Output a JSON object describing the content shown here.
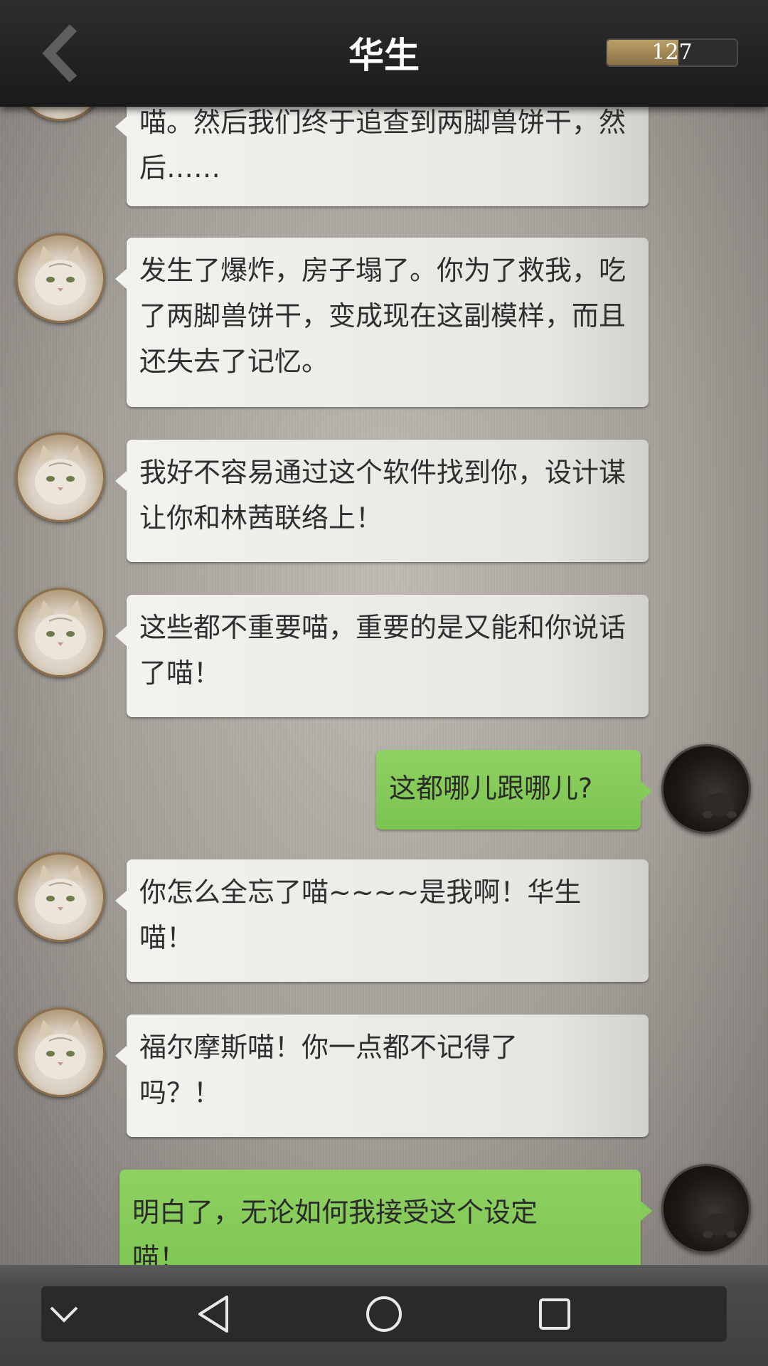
{
  "header": {
    "title": "华生",
    "counter_value": "127",
    "counter_fill_fraction": 0.55,
    "back_icon": "chevron-left-icon"
  },
  "messages": [
    {
      "side": "left",
      "text": "喵。然后我们终于追查到两脚兽饼干，然后……"
    },
    {
      "side": "left",
      "text": "发生了爆炸，房子塌了。你为了救我，吃了两脚兽饼干，变成现在这副模样，而且还失去了记忆。"
    },
    {
      "side": "left",
      "text": "我好不容易通过这个软件找到你，设计谋让你和林茜联络上！"
    },
    {
      "side": "left",
      "text": "这些都不重要喵，重要的是又能和你说话了喵！"
    },
    {
      "side": "right",
      "text": "这都哪儿跟哪儿?"
    },
    {
      "side": "left",
      "text": "你怎么全忘了喵~~~~是我啊！华生喵！"
    },
    {
      "side": "left",
      "text": "福尔摩斯喵！你一点都不记得了吗？！"
    },
    {
      "side": "right",
      "text": "明白了，无论如何我接受这个设定喵！"
    }
  ],
  "navbar": {
    "icons": [
      "chevron-down-icon",
      "back-triangle-icon",
      "home-circle-icon",
      "recents-square-icon"
    ]
  },
  "colors": {
    "header_bg": "#1f1f1f",
    "incoming_bubble": "#ebebe8",
    "outgoing_bubble": "#84c95a",
    "counter_fill": "#a68b55"
  }
}
